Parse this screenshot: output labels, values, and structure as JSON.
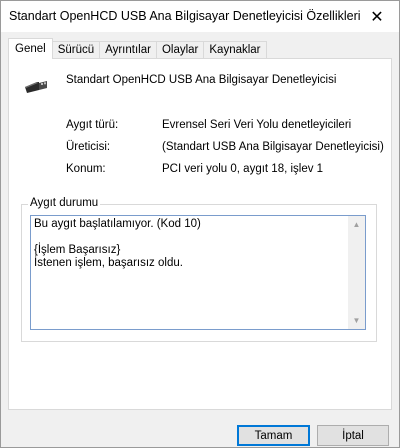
{
  "window": {
    "title": "Standart OpenHCD USB Ana Bilgisayar Denetleyicisi Özellikleri",
    "close_glyph": "✕"
  },
  "tabs": [
    {
      "label": "Genel",
      "active": true
    },
    {
      "label": "Sürücü",
      "active": false
    },
    {
      "label": "Ayrıntılar",
      "active": false
    },
    {
      "label": "Olaylar",
      "active": false
    },
    {
      "label": "Kaynaklar",
      "active": false
    }
  ],
  "device": {
    "icon": "usb-connector-icon",
    "name": "Standart OpenHCD USB Ana Bilgisayar Denetleyicisi",
    "properties": [
      {
        "label": "Aygıt türü:",
        "value": "Evrensel Seri Veri Yolu denetleyicileri"
      },
      {
        "label": "Üreticisi:",
        "value": "(Standart USB Ana Bilgisayar Denetleyicisi)"
      },
      {
        "label": "Konum:",
        "value": "PCI veri yolu 0, aygıt 18, işlev 1"
      }
    ]
  },
  "status": {
    "group_title": "Aygıt durumu",
    "text": "Bu aygıt başlatılamıyor. (Kod 10)\n\n{İşlem Başarısız}\nİstenen işlem, başarısız oldu."
  },
  "buttons": {
    "ok": "Tamam",
    "cancel": "İptal"
  },
  "colors": {
    "window_bg": "#f0f0f0",
    "panel_bg": "#ffffff",
    "focus_border": "#0078d7"
  }
}
